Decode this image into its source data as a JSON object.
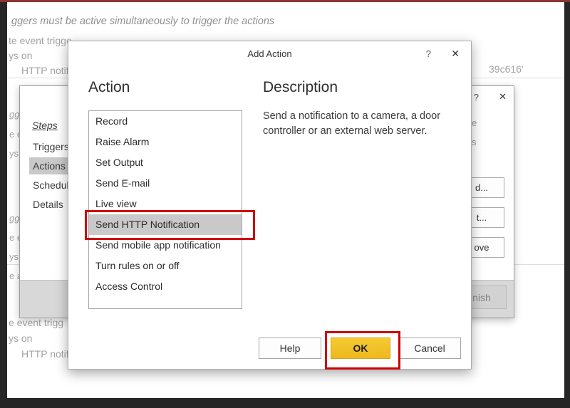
{
  "colors": {
    "annotation": "#ce0000",
    "ok_button": "#f2c230",
    "selected_row": "#c9c9c9"
  },
  "background": {
    "top_line_italic": "ggers must be active simultaneously to trigger the actions",
    "row_event": "te event trigge",
    "row_always": "ys on",
    "row_http": "HTTP notifica",
    "guid_fragment": "39c616'",
    "bottom_row_event": "e event trigg",
    "bottom_row_always": "ys on",
    "bottom_row_http": "HTTP notifica",
    "left_fragments": [
      "gge",
      "e e",
      "ys",
      "gge",
      "e e",
      "ys",
      "e al"
    ]
  },
  "wizard": {
    "help_icon": "?",
    "close_icon": "✕",
    "steps_title": "Steps",
    "steps": [
      "Triggers",
      "Actions",
      "Schedule",
      "Details"
    ],
    "selected_step": "Actions",
    "right_fragments": [
      "e",
      "s"
    ],
    "button_fragments": [
      "d...",
      "t...",
      "ove"
    ],
    "finish_fragment": "nish"
  },
  "dialog": {
    "title": "Add Action",
    "help_icon": "?",
    "close_icon": "✕",
    "action_heading": "Action",
    "actions": [
      "Record",
      "Raise Alarm",
      "Set Output",
      "Send E-mail",
      "Live view",
      "Send HTTP Notification",
      "Send mobile app notification",
      "Turn rules on or off",
      "Access Control"
    ],
    "selected_action": "Send HTTP Notification",
    "description_heading": "Description",
    "description_text": "Send a notification to a camera, a door controller or an external web server.",
    "help_button": "Help",
    "ok_button": "OK",
    "cancel_button": "Cancel"
  }
}
